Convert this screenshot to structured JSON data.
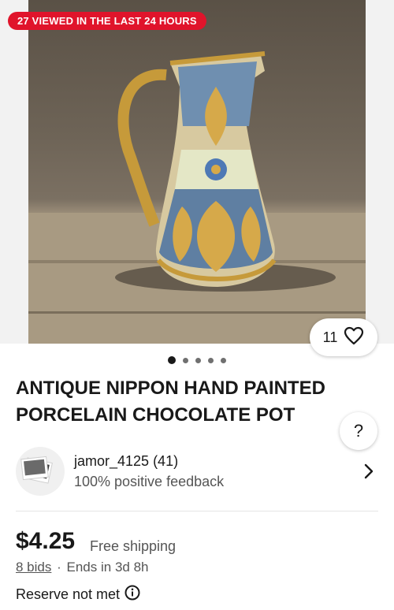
{
  "badge": {
    "text": "27 VIEWED IN THE LAST 24 HOURS",
    "color": "#e0142b"
  },
  "photo": {
    "subject": "antique porcelain chocolate pot",
    "icon": "product-photo"
  },
  "watch": {
    "count": "11",
    "icon": "heart-icon"
  },
  "carousel": {
    "total": 5,
    "active": 1
  },
  "listing": {
    "title": "ANTIQUE NIPPON HAND PAINTED PORCELAIN CHOCOLATE POT",
    "help_label": "?"
  },
  "seller": {
    "name": "jamor_4125 (41)",
    "feedback": "100% positive feedback",
    "icon": "chevron-right-icon"
  },
  "pricing": {
    "price": "$4.25",
    "shipping": "Free shipping",
    "bids": "8 bids",
    "separator": "·",
    "ends": "Ends in 3d 8h",
    "reserve": "Reserve not met",
    "reserve_icon": "info-icon"
  }
}
